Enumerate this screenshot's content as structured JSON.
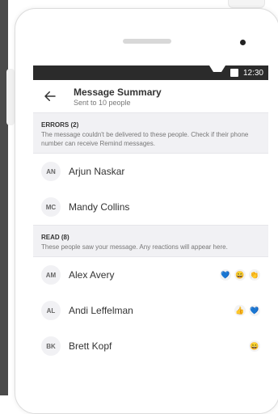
{
  "status": {
    "time": "12:30"
  },
  "header": {
    "title": "Message Summary",
    "subtitle": "Sent to 10 people"
  },
  "errors": {
    "heading": "ERRORS (2)",
    "description": "The message couldn't be delivered to these people. Check if their phone number can receive Remind messages.",
    "people": [
      {
        "initials": "AN",
        "name": "Arjun Naskar"
      },
      {
        "initials": "MC",
        "name": "Mandy Collins"
      }
    ]
  },
  "read": {
    "heading": "READ (8)",
    "description": "These people saw your message. Any reactions will appear here.",
    "people": [
      {
        "initials": "AM",
        "name": "Alex Avery",
        "reactions": [
          "💙",
          "😄",
          "👏"
        ]
      },
      {
        "initials": "AL",
        "name": "Andi Leffelman",
        "reactions": [
          "👍",
          "💙"
        ]
      },
      {
        "initials": "BK",
        "name": "Brett Kopf",
        "reactions": [
          "😄"
        ]
      }
    ]
  }
}
